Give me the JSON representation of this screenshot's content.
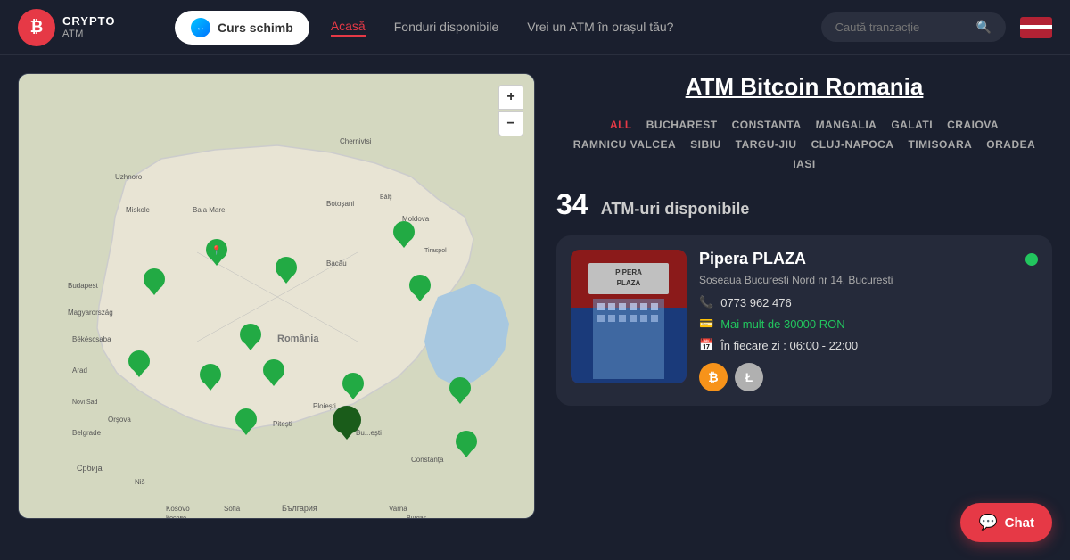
{
  "header": {
    "logo": {
      "symbol": "₿",
      "line1": "CRYPTO",
      "line2": "ATM"
    },
    "curs_button": "Curs schimb",
    "nav": [
      {
        "label": "Acasă",
        "active": true
      },
      {
        "label": "Fonduri disponibile",
        "active": false
      },
      {
        "label": "Vrei un ATM în orașul tău?",
        "active": false
      }
    ],
    "search_placeholder": "Caută tranzacție"
  },
  "main": {
    "title": "ATM Bitcoin Romania",
    "city_filters": [
      {
        "label": "ALL",
        "active": true
      },
      {
        "label": "BUCHAREST",
        "active": false
      },
      {
        "label": "CONSTANTA",
        "active": false
      },
      {
        "label": "MANGALIA",
        "active": false
      },
      {
        "label": "GALATI",
        "active": false
      },
      {
        "label": "CRAIOVA",
        "active": false
      },
      {
        "label": "RAMNICU VALCEA",
        "active": false
      },
      {
        "label": "SIBIU",
        "active": false
      },
      {
        "label": "TARGU-JIU",
        "active": false
      },
      {
        "label": "CLUJ-NAPOCA",
        "active": false
      },
      {
        "label": "TIMISOARA",
        "active": false
      },
      {
        "label": "ORADEA",
        "active": false
      },
      {
        "label": "IASI",
        "active": false
      }
    ],
    "atm_count": "34",
    "atm_count_label": "ATM-uri disponibile",
    "atm_card": {
      "name": "Pipera PLAZA",
      "address": "Soseaua Bucuresti Nord nr 14, Bucuresti",
      "phone": "0773 962 476",
      "cash": "Mai mult de 30000 RON",
      "hours": "În fiecare zi : 06:00 - 22:00",
      "status": "online",
      "coins": [
        "BTC",
        "LTC"
      ]
    }
  },
  "map": {
    "zoom_plus": "+",
    "zoom_minus": "−"
  },
  "chat": {
    "label": "Chat"
  }
}
